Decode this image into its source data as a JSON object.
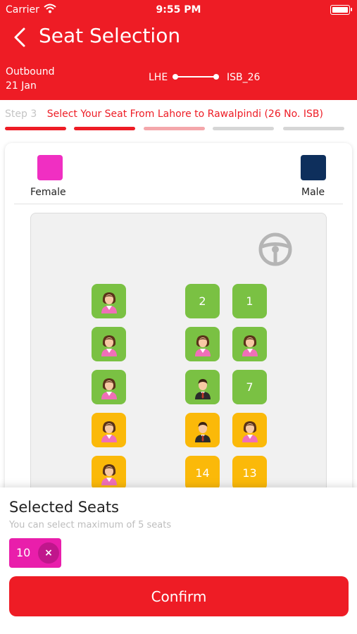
{
  "status_bar": {
    "carrier": "Carrier",
    "time": "9:55 PM"
  },
  "header": {
    "title": "Seat Selection",
    "back_icon": "chevron-left-icon"
  },
  "route": {
    "direction": "Outbound",
    "date": "21 Jan",
    "from": "LHE",
    "to": "ISB_26"
  },
  "step": {
    "label": "Step 3",
    "description": "Select Your Seat From Lahore to Rawalpindi (26 No. ISB)",
    "segment_colors": [
      "#ee1c25",
      "#ee1c25",
      "#f4a7ab",
      "#d6d6d6",
      "#d6d6d6"
    ]
  },
  "legend": {
    "female": {
      "label": "Female",
      "color": "#f02fc2"
    },
    "male": {
      "label": "Male",
      "color": "#0e2f5c"
    }
  },
  "colors": {
    "brand": "#ee1c25",
    "available": "#7ac143",
    "reserved": "#fbb909",
    "selected_chip": "#e91eab"
  },
  "seats": [
    {
      "label": "",
      "status": "available",
      "occupant": "female"
    },
    {
      "label": "2",
      "status": "available",
      "occupant": null
    },
    {
      "label": "1",
      "status": "available",
      "occupant": null
    },
    {
      "label": "",
      "status": "available",
      "occupant": "female"
    },
    {
      "label": "",
      "status": "available",
      "occupant": "female"
    },
    {
      "label": "",
      "status": "available",
      "occupant": "female"
    },
    {
      "label": "",
      "status": "available",
      "occupant": "female"
    },
    {
      "label": "",
      "status": "available",
      "occupant": "male"
    },
    {
      "label": "7",
      "status": "available",
      "occupant": null
    },
    {
      "label": "",
      "status": "reserved",
      "occupant": "female"
    },
    {
      "label": "",
      "status": "reserved",
      "occupant": "male"
    },
    {
      "label": "",
      "status": "reserved",
      "occupant": "female"
    },
    {
      "label": "",
      "status": "reserved",
      "occupant": "female"
    },
    {
      "label": "14",
      "status": "reserved",
      "occupant": null
    },
    {
      "label": "13",
      "status": "reserved",
      "occupant": null
    }
  ],
  "selected": {
    "title": "Selected Seats",
    "subtitle": "You can select maximum of 5 seats",
    "chips": [
      {
        "seat": "10",
        "remove": "×"
      }
    ]
  },
  "confirm_label": "Confirm"
}
